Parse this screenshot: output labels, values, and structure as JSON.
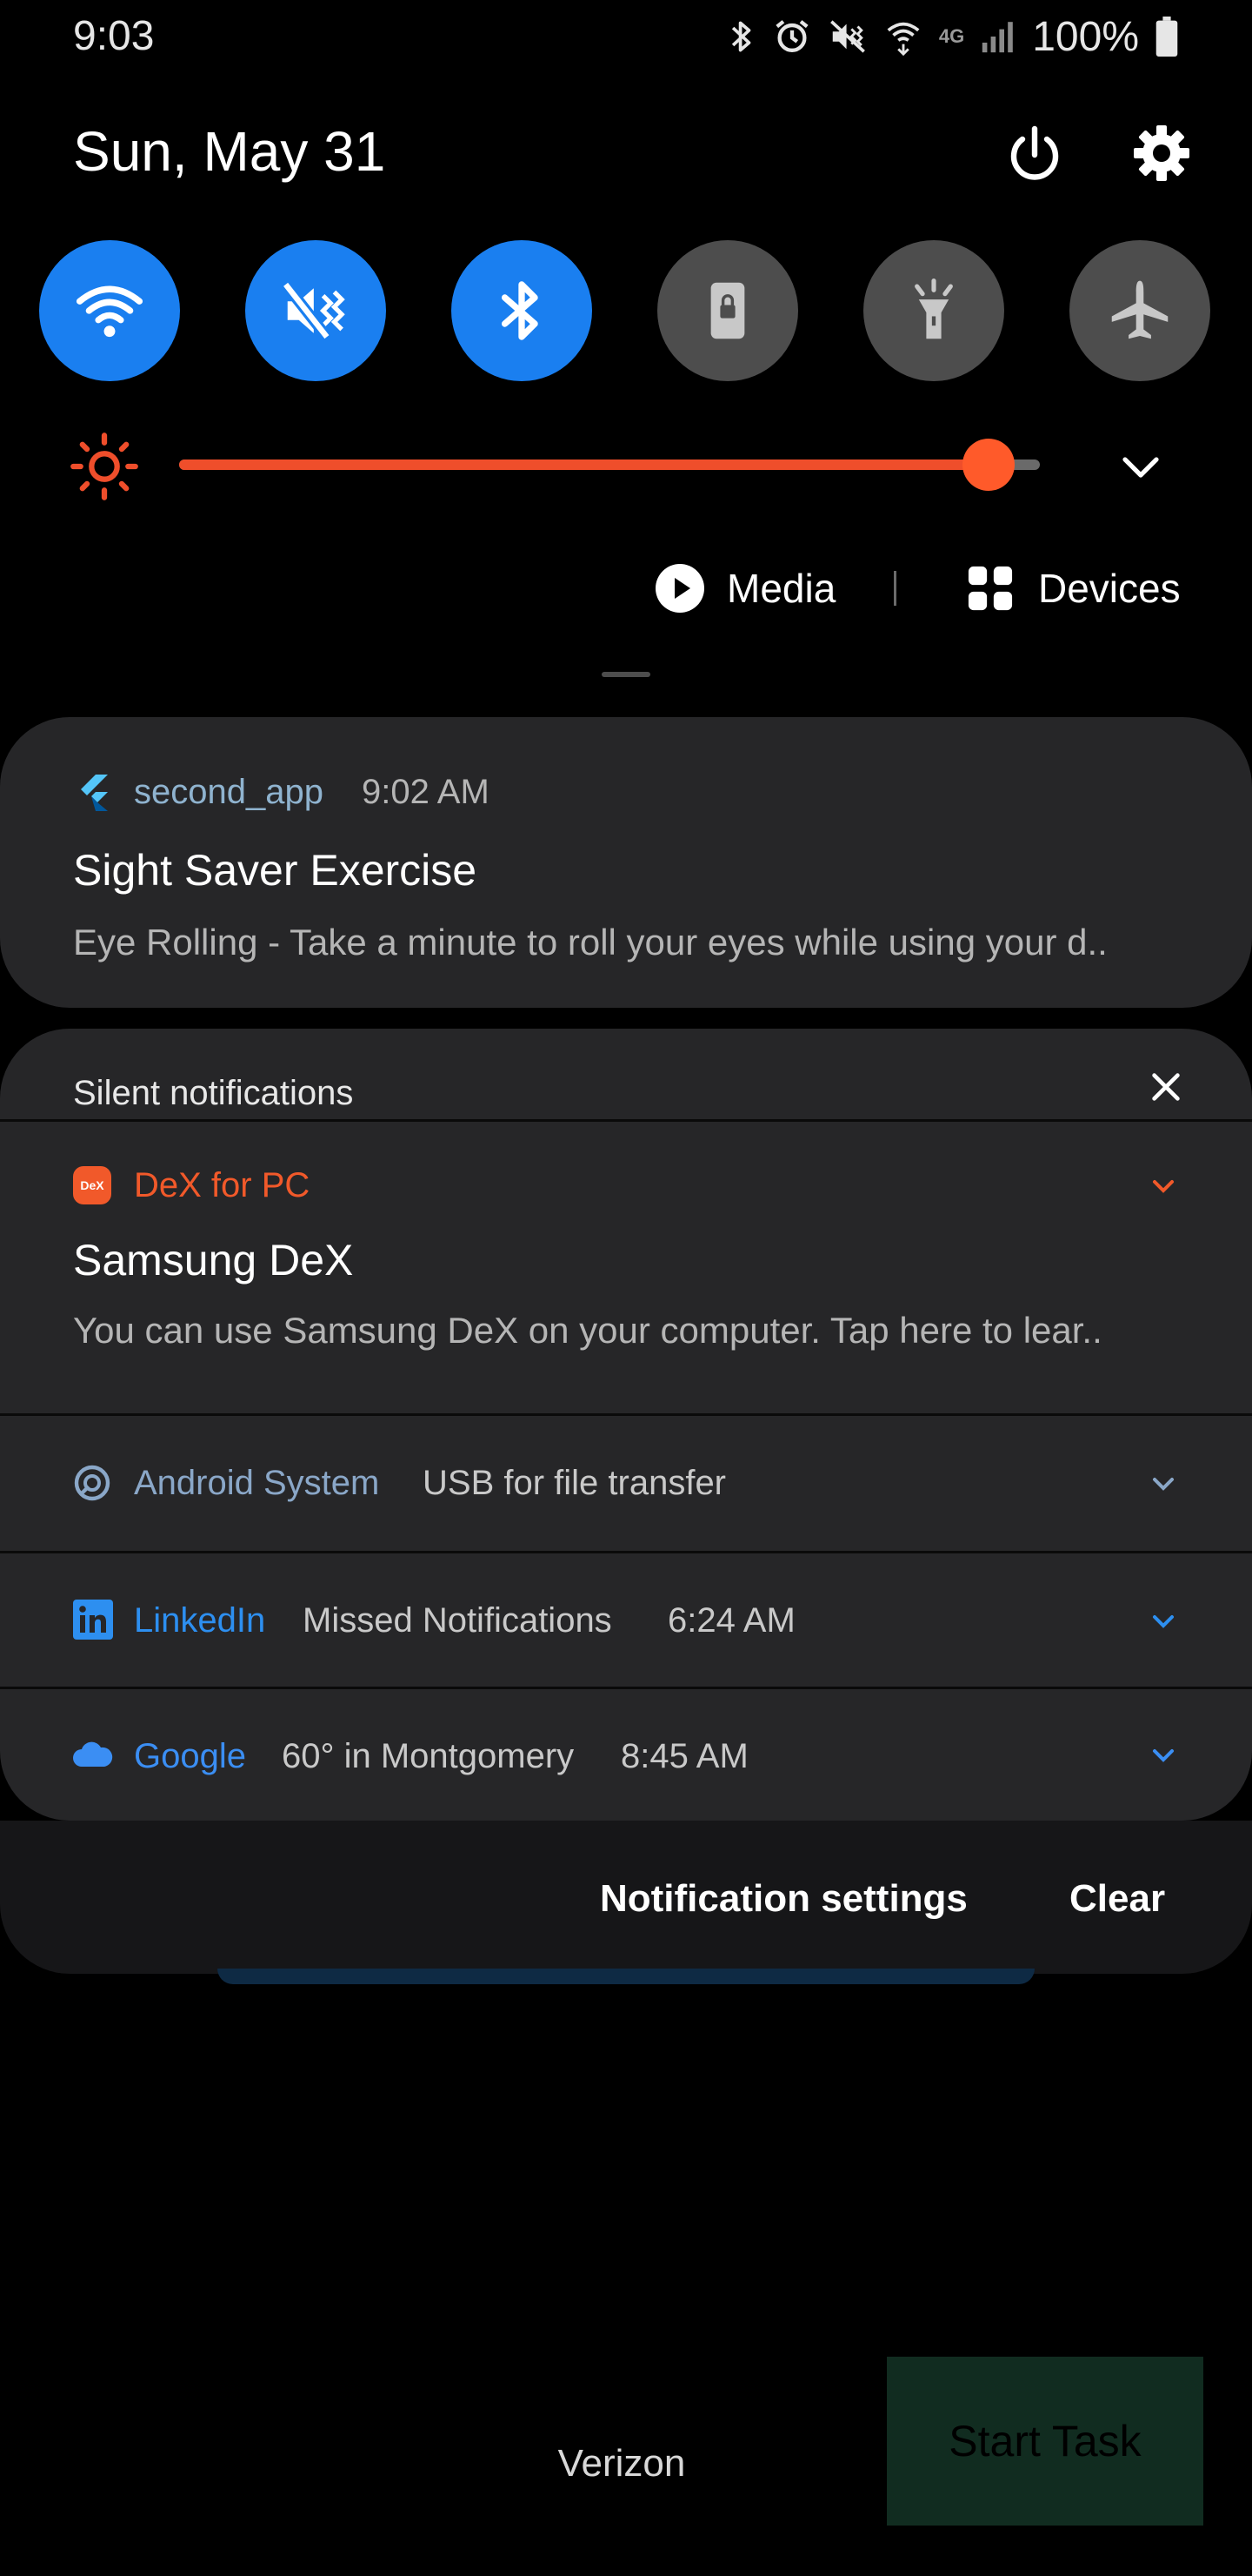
{
  "status_bar": {
    "time": "9:03",
    "battery": "100%",
    "icons": [
      "bluetooth-icon",
      "alarm-icon",
      "vibrate-icon",
      "wifi-calling-icon",
      "4g-lte-icon",
      "signal-icon",
      "battery-icon"
    ]
  },
  "header": {
    "date": "Sun, May 31",
    "power_icon": "power-icon",
    "settings_icon": "gear-icon"
  },
  "quick_settings": [
    {
      "name": "wifi",
      "state": "on",
      "icon": "wifi-icon"
    },
    {
      "name": "mute",
      "state": "on",
      "icon": "mute-icon"
    },
    {
      "name": "bluetooth",
      "state": "on",
      "icon": "bluetooth-icon"
    },
    {
      "name": "rotation-lock",
      "state": "off",
      "icon": "lock-icon"
    },
    {
      "name": "flashlight",
      "state": "off",
      "icon": "flashlight-icon"
    },
    {
      "name": "airplane",
      "state": "off",
      "icon": "airplane-icon"
    }
  ],
  "brightness": {
    "level": 0.94,
    "icon": "sun-icon",
    "color": "#ef4e2b"
  },
  "media_row": {
    "media_label": "Media",
    "devices_label": "Devices"
  },
  "notifications": {
    "main": {
      "app": "second_app",
      "time": "9:02 AM",
      "title": "Sight Saver Exercise",
      "body": "Eye Rolling - Take a minute to roll your eyes while using your d.."
    },
    "silent_header": "Silent notifications",
    "dex": {
      "app": "DeX for PC",
      "badge": "DeX",
      "title": "Samsung DeX",
      "body": "You can use Samsung DeX on your computer. Tap here to lear..",
      "accent": "#f1592a"
    },
    "android": {
      "app": "Android System",
      "text": "USB for file transfer",
      "accent": "#8aa7c8"
    },
    "linkedin": {
      "app": "LinkedIn",
      "text": "Missed Notifications",
      "time": "6:24 AM",
      "accent": "#2d8ff0"
    },
    "google": {
      "app": "Google",
      "text": "60° in Montgomery",
      "time": "8:45 AM",
      "accent": "#3b8ef3"
    }
  },
  "actions": {
    "settings": "Notification settings",
    "clear": "Clear"
  },
  "background_app": {
    "carrier": "Verizon",
    "start_task": "Start Task"
  }
}
